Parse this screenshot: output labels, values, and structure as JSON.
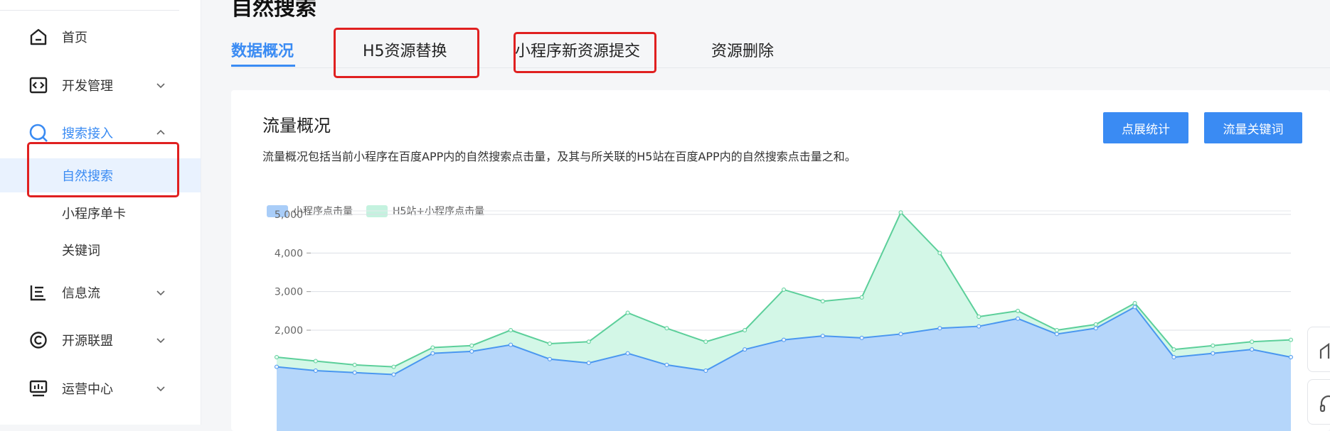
{
  "sidebar": {
    "items": [
      {
        "label": "首页",
        "icon": "home-icon"
      },
      {
        "label": "开发管理",
        "icon": "code-icon"
      },
      {
        "label": "搜索接入",
        "icon": "search-icon"
      },
      {
        "label": "信息流",
        "icon": "feed-icon"
      },
      {
        "label": "开源联盟",
        "icon": "open-source-icon"
      },
      {
        "label": "运营中心",
        "icon": "monitor-icon"
      }
    ],
    "sub_items": [
      {
        "label": "自然搜索"
      },
      {
        "label": "小程序单卡"
      },
      {
        "label": "关键词"
      }
    ]
  },
  "header": {
    "title": "自然搜索",
    "tabs": [
      {
        "label": "数据概况"
      },
      {
        "label": "H5资源替换"
      },
      {
        "label": "小程序新资源提交"
      },
      {
        "label": "资源删除"
      }
    ]
  },
  "card": {
    "title": "流量概况",
    "description": "流量概况包括当前小程序在百度APP内的自然搜索点击量，及其与所关联的H5站在百度APP内的自然搜索点击量之和。",
    "buttons": {
      "stats": "点展统计",
      "keywords": "流量关键词"
    }
  },
  "colors": {
    "accent": "#3a8bf3",
    "annotation": "#e02020",
    "series_mini": "#4a97f0",
    "series_total": "#5ccf9a"
  },
  "chart_data": {
    "type": "area",
    "series": [
      {
        "name": "小程序点击量",
        "values": [
          1050,
          950,
          900,
          850,
          1400,
          1450,
          1620,
          1250,
          1150,
          1400,
          1100,
          950,
          1500,
          1750,
          1850,
          1800,
          1900,
          2050,
          2100,
          2300,
          1900,
          2050,
          2600,
          1300,
          1400,
          1500,
          1300
        ]
      },
      {
        "name": "H5站+小程序点击量",
        "values": [
          1300,
          1200,
          1100,
          1050,
          1550,
          1600,
          2000,
          1650,
          1700,
          2450,
          2050,
          1700,
          2000,
          3050,
          2750,
          2850,
          5050,
          4000,
          2350,
          2500,
          2000,
          2150,
          2700,
          1500,
          1600,
          1700,
          1750
        ]
      }
    ],
    "ylim": [
      0,
      5100
    ],
    "yticks": [
      "5,000",
      "4,000",
      "3,000",
      "2,000"
    ],
    "grid": true,
    "legend": "top-left"
  }
}
